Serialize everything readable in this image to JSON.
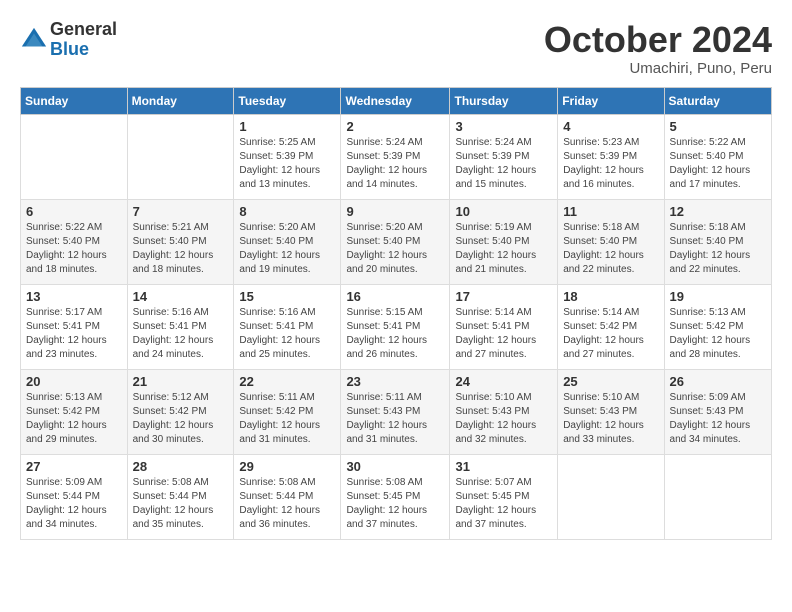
{
  "logo": {
    "general": "General",
    "blue": "Blue"
  },
  "title": "October 2024",
  "location": "Umachiri, Puno, Peru",
  "headers": [
    "Sunday",
    "Monday",
    "Tuesday",
    "Wednesday",
    "Thursday",
    "Friday",
    "Saturday"
  ],
  "weeks": [
    [
      {
        "day": "",
        "sunrise": "",
        "sunset": "",
        "daylight": ""
      },
      {
        "day": "",
        "sunrise": "",
        "sunset": "",
        "daylight": ""
      },
      {
        "day": "1",
        "sunrise": "Sunrise: 5:25 AM",
        "sunset": "Sunset: 5:39 PM",
        "daylight": "Daylight: 12 hours and 13 minutes."
      },
      {
        "day": "2",
        "sunrise": "Sunrise: 5:24 AM",
        "sunset": "Sunset: 5:39 PM",
        "daylight": "Daylight: 12 hours and 14 minutes."
      },
      {
        "day": "3",
        "sunrise": "Sunrise: 5:24 AM",
        "sunset": "Sunset: 5:39 PM",
        "daylight": "Daylight: 12 hours and 15 minutes."
      },
      {
        "day": "4",
        "sunrise": "Sunrise: 5:23 AM",
        "sunset": "Sunset: 5:39 PM",
        "daylight": "Daylight: 12 hours and 16 minutes."
      },
      {
        "day": "5",
        "sunrise": "Sunrise: 5:22 AM",
        "sunset": "Sunset: 5:40 PM",
        "daylight": "Daylight: 12 hours and 17 minutes."
      }
    ],
    [
      {
        "day": "6",
        "sunrise": "Sunrise: 5:22 AM",
        "sunset": "Sunset: 5:40 PM",
        "daylight": "Daylight: 12 hours and 18 minutes."
      },
      {
        "day": "7",
        "sunrise": "Sunrise: 5:21 AM",
        "sunset": "Sunset: 5:40 PM",
        "daylight": "Daylight: 12 hours and 18 minutes."
      },
      {
        "day": "8",
        "sunrise": "Sunrise: 5:20 AM",
        "sunset": "Sunset: 5:40 PM",
        "daylight": "Daylight: 12 hours and 19 minutes."
      },
      {
        "day": "9",
        "sunrise": "Sunrise: 5:20 AM",
        "sunset": "Sunset: 5:40 PM",
        "daylight": "Daylight: 12 hours and 20 minutes."
      },
      {
        "day": "10",
        "sunrise": "Sunrise: 5:19 AM",
        "sunset": "Sunset: 5:40 PM",
        "daylight": "Daylight: 12 hours and 21 minutes."
      },
      {
        "day": "11",
        "sunrise": "Sunrise: 5:18 AM",
        "sunset": "Sunset: 5:40 PM",
        "daylight": "Daylight: 12 hours and 22 minutes."
      },
      {
        "day": "12",
        "sunrise": "Sunrise: 5:18 AM",
        "sunset": "Sunset: 5:40 PM",
        "daylight": "Daylight: 12 hours and 22 minutes."
      }
    ],
    [
      {
        "day": "13",
        "sunrise": "Sunrise: 5:17 AM",
        "sunset": "Sunset: 5:41 PM",
        "daylight": "Daylight: 12 hours and 23 minutes."
      },
      {
        "day": "14",
        "sunrise": "Sunrise: 5:16 AM",
        "sunset": "Sunset: 5:41 PM",
        "daylight": "Daylight: 12 hours and 24 minutes."
      },
      {
        "day": "15",
        "sunrise": "Sunrise: 5:16 AM",
        "sunset": "Sunset: 5:41 PM",
        "daylight": "Daylight: 12 hours and 25 minutes."
      },
      {
        "day": "16",
        "sunrise": "Sunrise: 5:15 AM",
        "sunset": "Sunset: 5:41 PM",
        "daylight": "Daylight: 12 hours and 26 minutes."
      },
      {
        "day": "17",
        "sunrise": "Sunrise: 5:14 AM",
        "sunset": "Sunset: 5:41 PM",
        "daylight": "Daylight: 12 hours and 27 minutes."
      },
      {
        "day": "18",
        "sunrise": "Sunrise: 5:14 AM",
        "sunset": "Sunset: 5:42 PM",
        "daylight": "Daylight: 12 hours and 27 minutes."
      },
      {
        "day": "19",
        "sunrise": "Sunrise: 5:13 AM",
        "sunset": "Sunset: 5:42 PM",
        "daylight": "Daylight: 12 hours and 28 minutes."
      }
    ],
    [
      {
        "day": "20",
        "sunrise": "Sunrise: 5:13 AM",
        "sunset": "Sunset: 5:42 PM",
        "daylight": "Daylight: 12 hours and 29 minutes."
      },
      {
        "day": "21",
        "sunrise": "Sunrise: 5:12 AM",
        "sunset": "Sunset: 5:42 PM",
        "daylight": "Daylight: 12 hours and 30 minutes."
      },
      {
        "day": "22",
        "sunrise": "Sunrise: 5:11 AM",
        "sunset": "Sunset: 5:42 PM",
        "daylight": "Daylight: 12 hours and 31 minutes."
      },
      {
        "day": "23",
        "sunrise": "Sunrise: 5:11 AM",
        "sunset": "Sunset: 5:43 PM",
        "daylight": "Daylight: 12 hours and 31 minutes."
      },
      {
        "day": "24",
        "sunrise": "Sunrise: 5:10 AM",
        "sunset": "Sunset: 5:43 PM",
        "daylight": "Daylight: 12 hours and 32 minutes."
      },
      {
        "day": "25",
        "sunrise": "Sunrise: 5:10 AM",
        "sunset": "Sunset: 5:43 PM",
        "daylight": "Daylight: 12 hours and 33 minutes."
      },
      {
        "day": "26",
        "sunrise": "Sunrise: 5:09 AM",
        "sunset": "Sunset: 5:43 PM",
        "daylight": "Daylight: 12 hours and 34 minutes."
      }
    ],
    [
      {
        "day": "27",
        "sunrise": "Sunrise: 5:09 AM",
        "sunset": "Sunset: 5:44 PM",
        "daylight": "Daylight: 12 hours and 34 minutes."
      },
      {
        "day": "28",
        "sunrise": "Sunrise: 5:08 AM",
        "sunset": "Sunset: 5:44 PM",
        "daylight": "Daylight: 12 hours and 35 minutes."
      },
      {
        "day": "29",
        "sunrise": "Sunrise: 5:08 AM",
        "sunset": "Sunset: 5:44 PM",
        "daylight": "Daylight: 12 hours and 36 minutes."
      },
      {
        "day": "30",
        "sunrise": "Sunrise: 5:08 AM",
        "sunset": "Sunset: 5:45 PM",
        "daylight": "Daylight: 12 hours and 37 minutes."
      },
      {
        "day": "31",
        "sunrise": "Sunrise: 5:07 AM",
        "sunset": "Sunset: 5:45 PM",
        "daylight": "Daylight: 12 hours and 37 minutes."
      },
      {
        "day": "",
        "sunrise": "",
        "sunset": "",
        "daylight": ""
      },
      {
        "day": "",
        "sunrise": "",
        "sunset": "",
        "daylight": ""
      }
    ]
  ]
}
